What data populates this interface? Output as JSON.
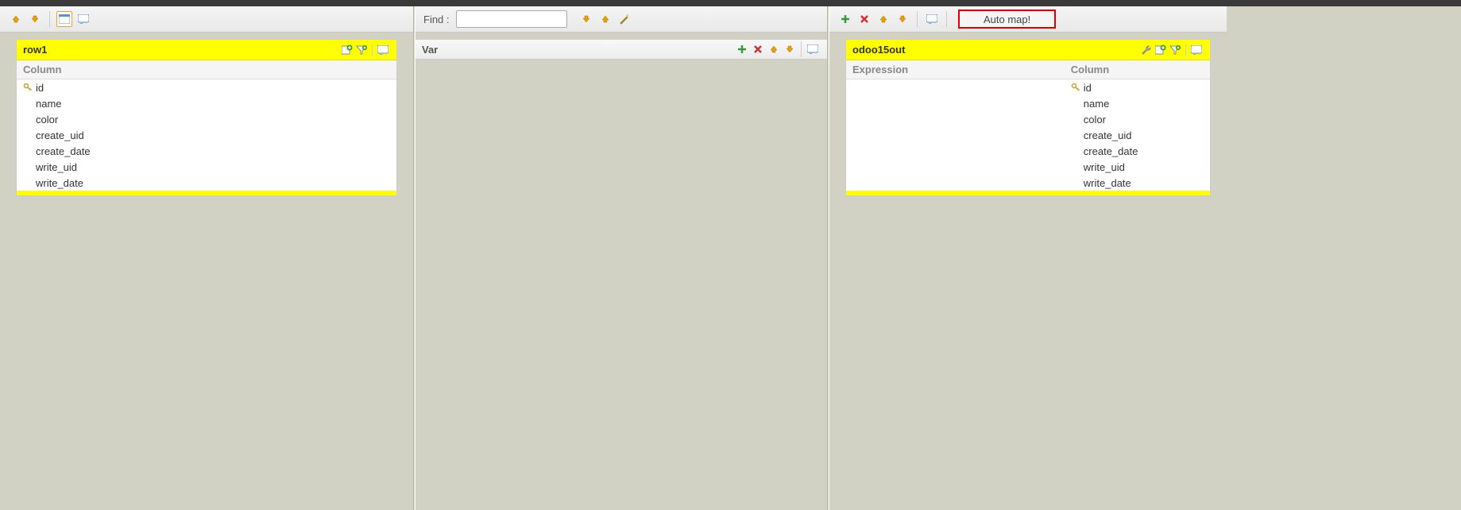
{
  "left": {
    "panel_title": "row1",
    "column_header": "Column",
    "rows": [
      {
        "key": true,
        "name": "id"
      },
      {
        "key": false,
        "name": "name"
      },
      {
        "key": false,
        "name": "color"
      },
      {
        "key": false,
        "name": "create_uid"
      },
      {
        "key": false,
        "name": "create_date"
      },
      {
        "key": false,
        "name": "write_uid"
      },
      {
        "key": false,
        "name": "write_date"
      }
    ]
  },
  "middle": {
    "find_label": "Find :",
    "find_value": "",
    "find_placeholder": "",
    "var_label": "Var"
  },
  "right": {
    "automap_label": "Auto map!",
    "panel_title": "odoo15out",
    "expression_header": "Expression",
    "column_header": "Column",
    "rows": [
      {
        "key": true,
        "name": "id"
      },
      {
        "key": false,
        "name": "name"
      },
      {
        "key": false,
        "name": "color"
      },
      {
        "key": false,
        "name": "create_uid"
      },
      {
        "key": false,
        "name": "create_date"
      },
      {
        "key": false,
        "name": "write_uid"
      },
      {
        "key": false,
        "name": "write_date"
      }
    ]
  }
}
